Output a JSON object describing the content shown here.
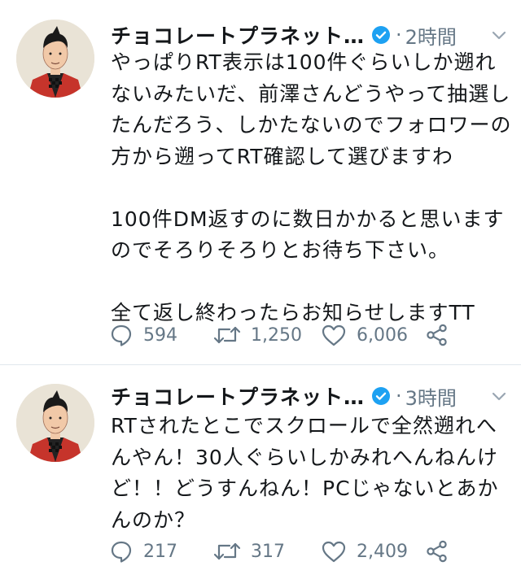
{
  "tweets": [
    {
      "author_name": "チョコレートプラネット…",
      "separator": "·",
      "time": "2時間",
      "text": "やっぱりRT表示は100件ぐらいしか遡れないみたいだ、前澤さんどうやって抽選したんだろう、しかたないのでフォロワーの方から遡ってRT確認して選びますわ\n\n100件DM返すのに数日かかると思いますのでそろりそろりとお待ち下さい。\n\n全て返し終わったらお知らせしますTT",
      "replies": "594",
      "retweets": "1,250",
      "likes": "6,006"
    },
    {
      "author_name": "チョコレートプラネット…",
      "separator": "·",
      "time": "3時間",
      "text": "RTされたとこでスクロールで全然遡れへんやん！30人ぐらいしかみれへんねんけど！！どうすんねん！PCじゃないとあかんのか？",
      "replies": "217",
      "retweets": "317",
      "likes": "2,409"
    }
  ],
  "icons": {
    "verified": "verified-badge-icon",
    "caret": "chevron-down-icon",
    "reply": "reply-icon",
    "retweet": "retweet-icon",
    "like": "heart-icon",
    "share": "share-icon"
  },
  "colors": {
    "verified_blue": "#1da1f2",
    "muted_gray": "#657786",
    "avatar_jacket_red": "#c6342b"
  }
}
